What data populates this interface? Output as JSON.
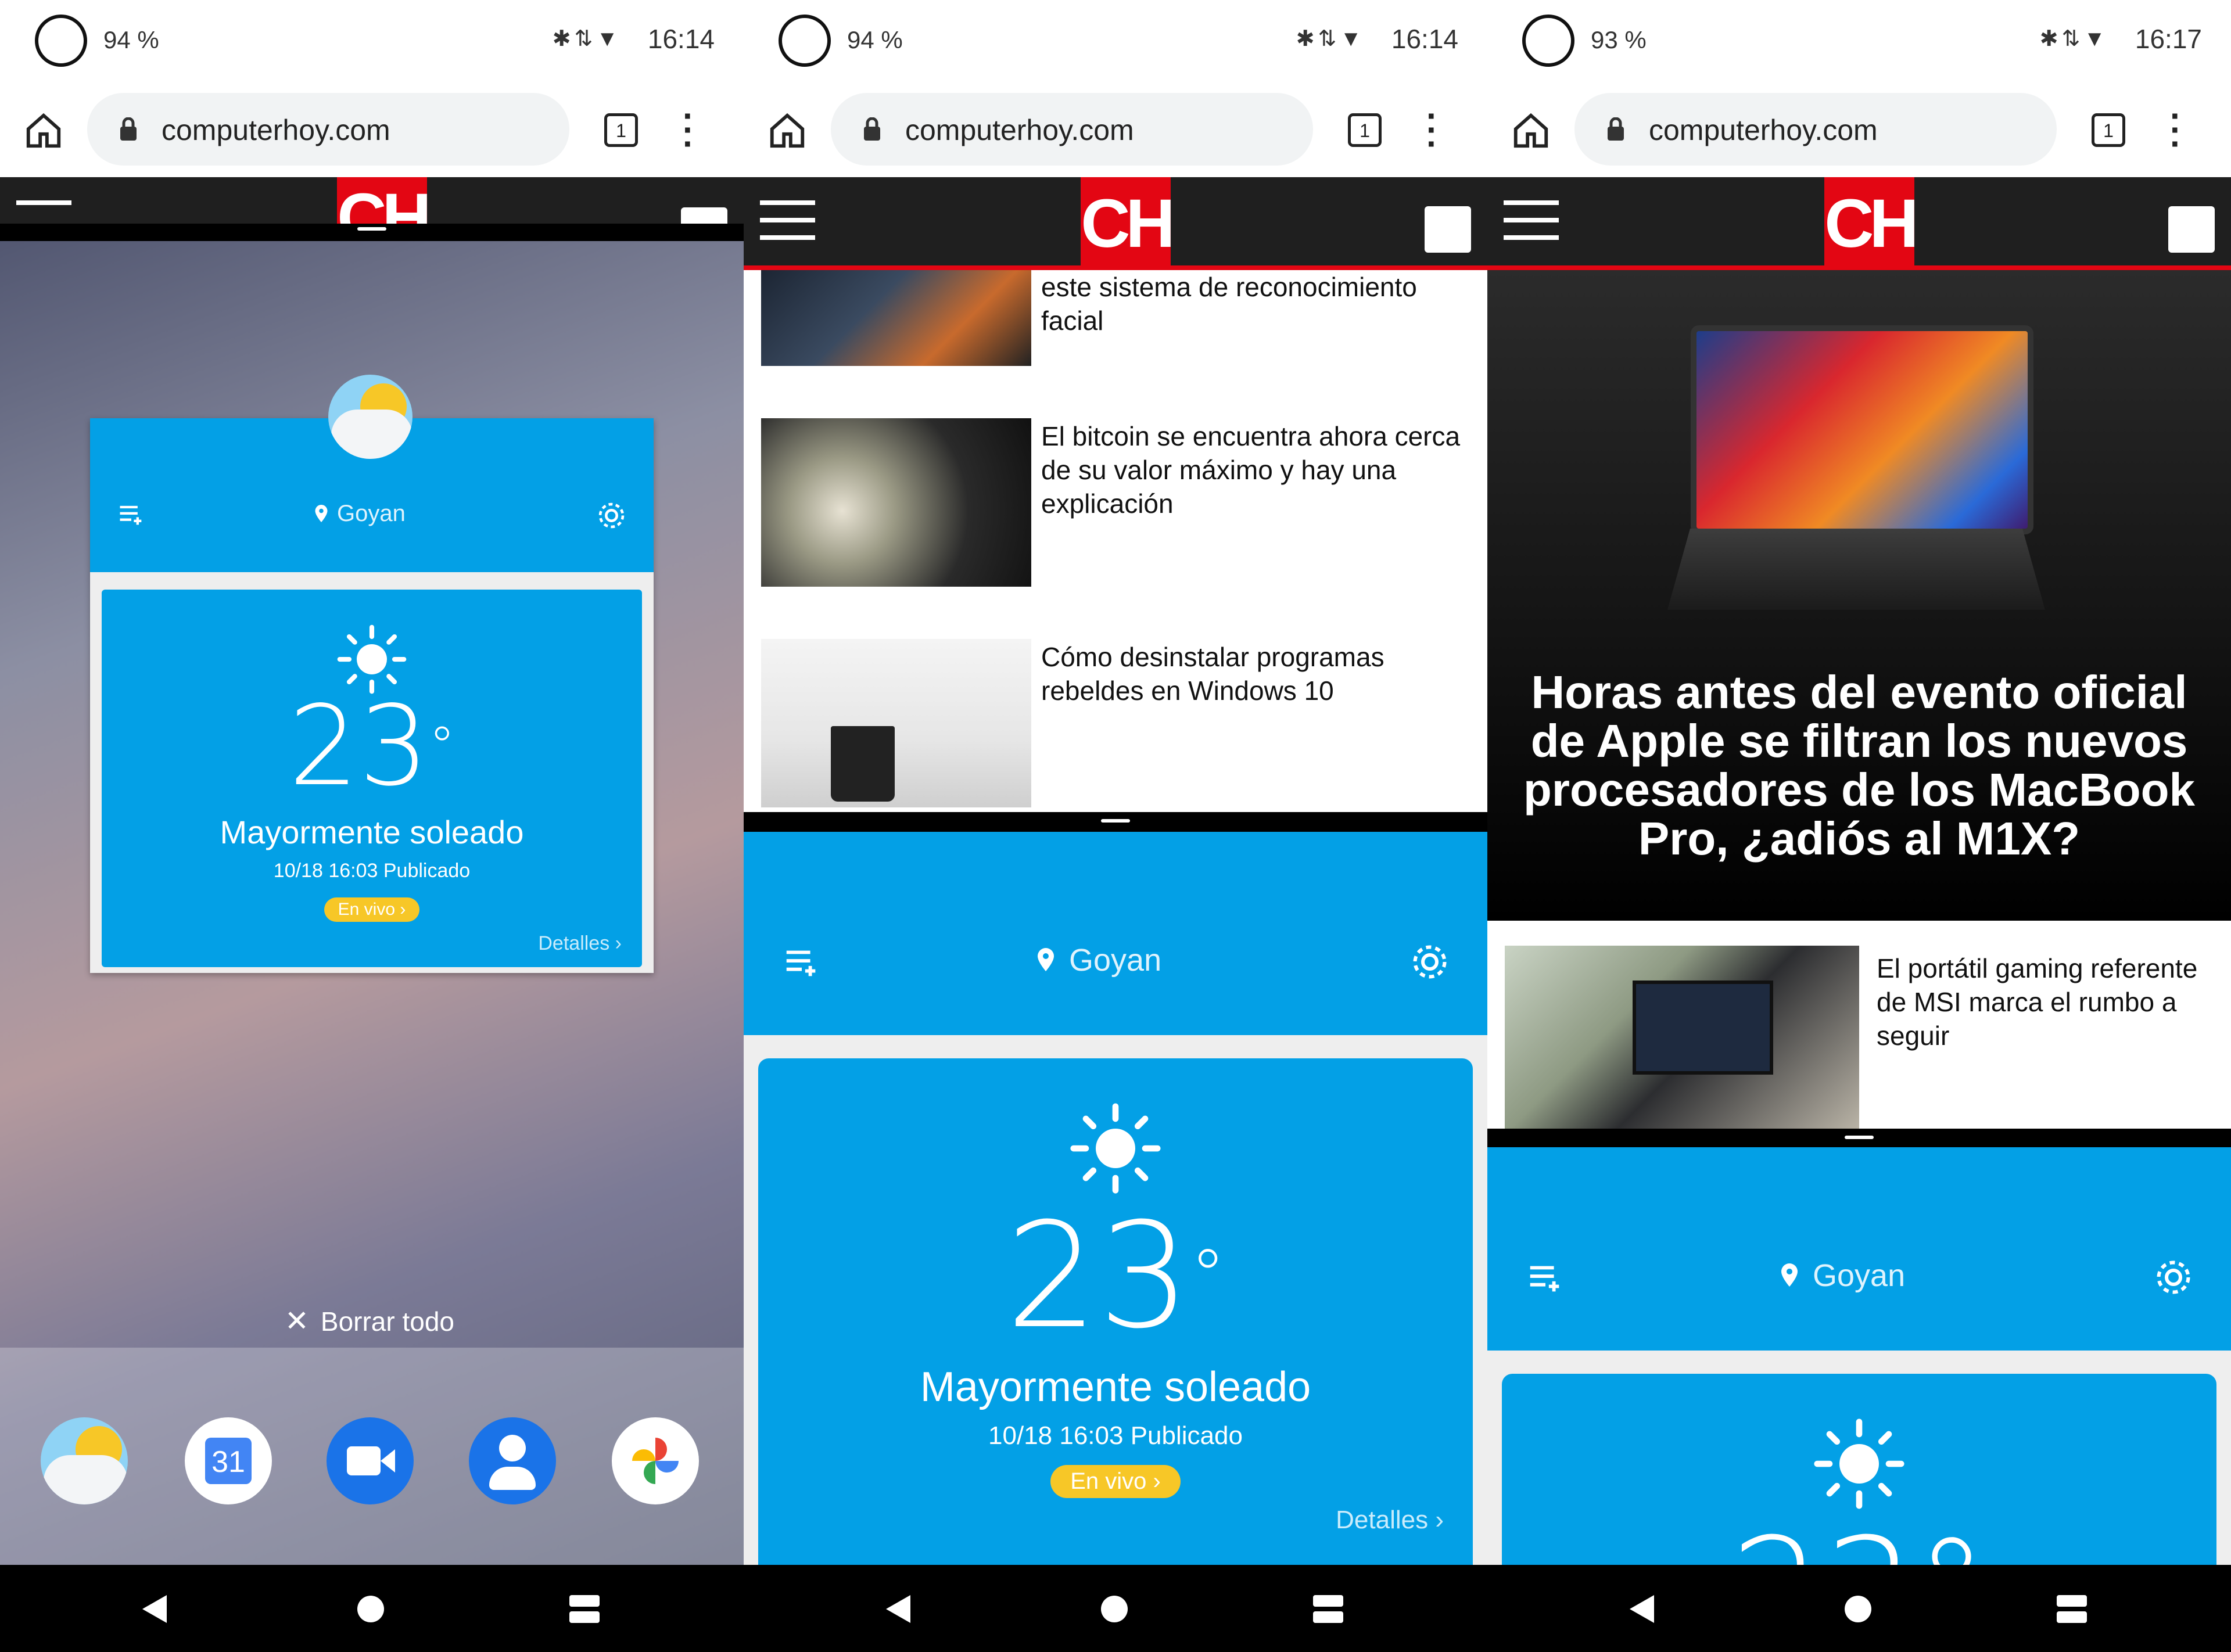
{
  "status": [
    {
      "battery": "94 %",
      "time": "16:14"
    },
    {
      "battery": "94 %",
      "time": "16:14"
    },
    {
      "battery": "93 %",
      "time": "16:17"
    }
  ],
  "browser": {
    "url": "computerhoy.com",
    "tab_count": "1"
  },
  "site": {
    "logo": "CH"
  },
  "weather": {
    "location": "Goyan",
    "temperature": "23",
    "degree": "°",
    "condition": "Mayormente soleado",
    "published": "10/18 16:03 Publicado",
    "live_label": "En vivo",
    "details_label": "Detalles",
    "partial_temperature": "23°"
  },
  "recents": {
    "clear_all_label": "Borrar todo"
  },
  "dock": {
    "apps": [
      "weather-app",
      "calendar-app",
      "duo-app",
      "contacts-app",
      "photos-app"
    ],
    "calendar_day": "31"
  },
  "articles_panel2": [
    {
      "title": "este sistema de reconocimiento facial"
    },
    {
      "title": "El bitcoin se encuentra ahora cerca de su valor máximo y hay una explicación"
    },
    {
      "title": "Cómo desinstalar programas rebeldes en Windows 10"
    }
  ],
  "hero": {
    "title": "Horas antes del evento oficial de Apple se filtran los nuevos procesadores de los MacBook Pro, ¿adiós al M1X?"
  },
  "articles_panel3": [
    {
      "title": "El portátil gaming referente de MSI marca el rumbo a seguir"
    }
  ],
  "colors": {
    "weather_blue": "#03a0e6",
    "brand_red": "#e30613",
    "live_yellow": "#f7c727"
  }
}
